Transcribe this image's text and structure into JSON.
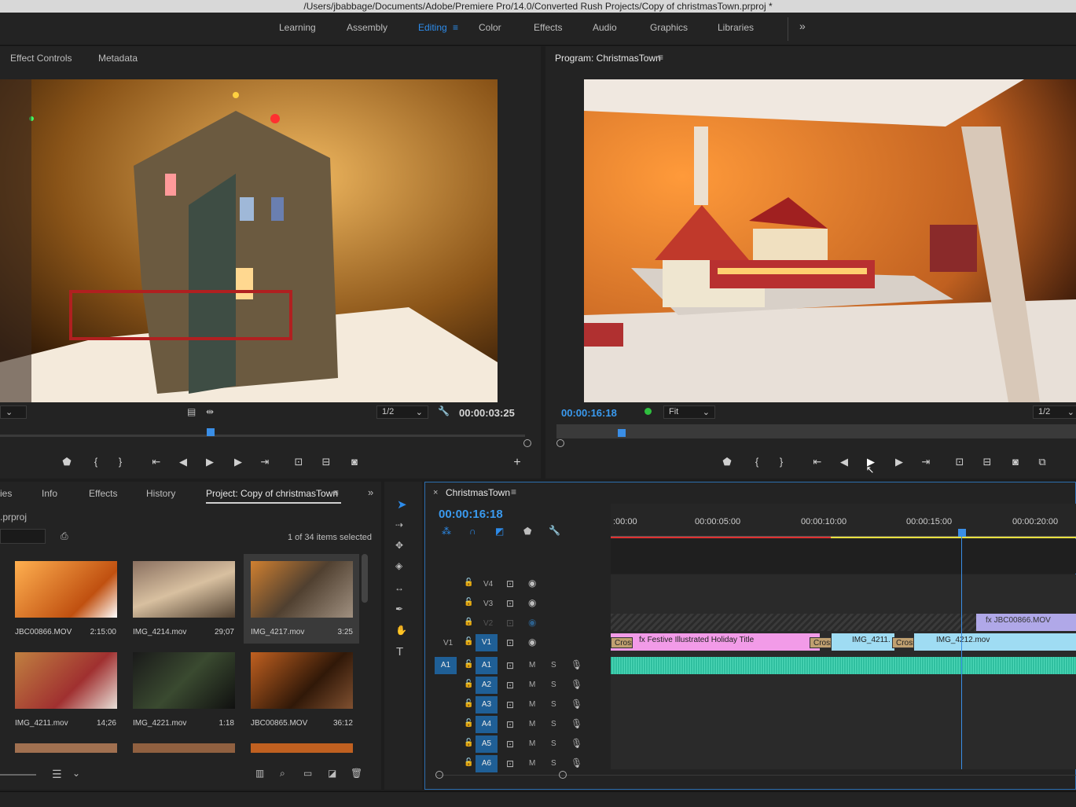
{
  "window": {
    "title": "/Users/jbabbage/Documents/Adobe/Premiere Pro/14.0/Converted Rush Projects/Copy of christmasTown.prproj *"
  },
  "workspaces": {
    "items": [
      "Learning",
      "Assembly",
      "Editing",
      "Color",
      "Effects",
      "Audio",
      "Graphics",
      "Libraries"
    ],
    "active": "Editing",
    "overflow": "»"
  },
  "source_panel": {
    "tabs": [
      "Effect Controls",
      "Metadata"
    ],
    "resolution": "1/2",
    "timecode": "00:00:03:25"
  },
  "program_panel": {
    "title": "Program: ChristmasTown",
    "timecode": "00:00:16:18",
    "zoom": "Fit",
    "resolution": "1/2"
  },
  "project_panel": {
    "tabs": [
      "ies",
      "Info",
      "Effects",
      "History",
      "Project: Copy of christmasTown"
    ],
    "active_tab": "Project: Copy of christmasTown",
    "file_fragment": ".prproj",
    "selection_status": "1 of 34 items selected",
    "items": [
      {
        "name": "JBC00866.MOV",
        "duration": "2:15:00"
      },
      {
        "name": "IMG_4214.mov",
        "duration": "29;07"
      },
      {
        "name": "IMG_4217.mov",
        "duration": "3:25"
      },
      {
        "name": "IMG_4211.mov",
        "duration": "14;26"
      },
      {
        "name": "IMG_4221.mov",
        "duration": "1:18"
      },
      {
        "name": "JBC00865.MOV",
        "duration": "36:12"
      }
    ]
  },
  "timeline": {
    "sequence_name": "ChristmasTown",
    "timecode": "00:00:16:18",
    "ruler": [
      ":00:00",
      "00:00:05:00",
      "00:00:10:00",
      "00:00:15:00",
      "00:00:20:00"
    ],
    "video_tracks": [
      {
        "label": "V4",
        "source_patch": ""
      },
      {
        "label": "V3",
        "source_patch": ""
      },
      {
        "label": "V2",
        "source_patch": ""
      },
      {
        "label": "V1",
        "source_patch": "V1"
      }
    ],
    "audio_tracks": [
      {
        "label": "A1",
        "source_patch": "A1"
      },
      {
        "label": "A2"
      },
      {
        "label": "A3"
      },
      {
        "label": "A4"
      },
      {
        "label": "A5"
      },
      {
        "label": "A6"
      }
    ],
    "mute_label": "M",
    "solo_label": "S",
    "clips": {
      "v2_clip": "JBC00866.MOV",
      "title_clip": "Festive Illustrated Holiday Title",
      "clip_a": "IMG_4211.",
      "clip_b": "IMG_4212.mov",
      "transition_label": "Cross"
    }
  },
  "colors": {
    "accent": "#2d8ceb",
    "title_clip": "#f29be8",
    "video_clip": "#9fdcf3",
    "audio_clip": "#2fbf9f",
    "playhead": "#3a8ee6",
    "in_out_red": "#e03030",
    "render_yellow": "#e8e040"
  }
}
